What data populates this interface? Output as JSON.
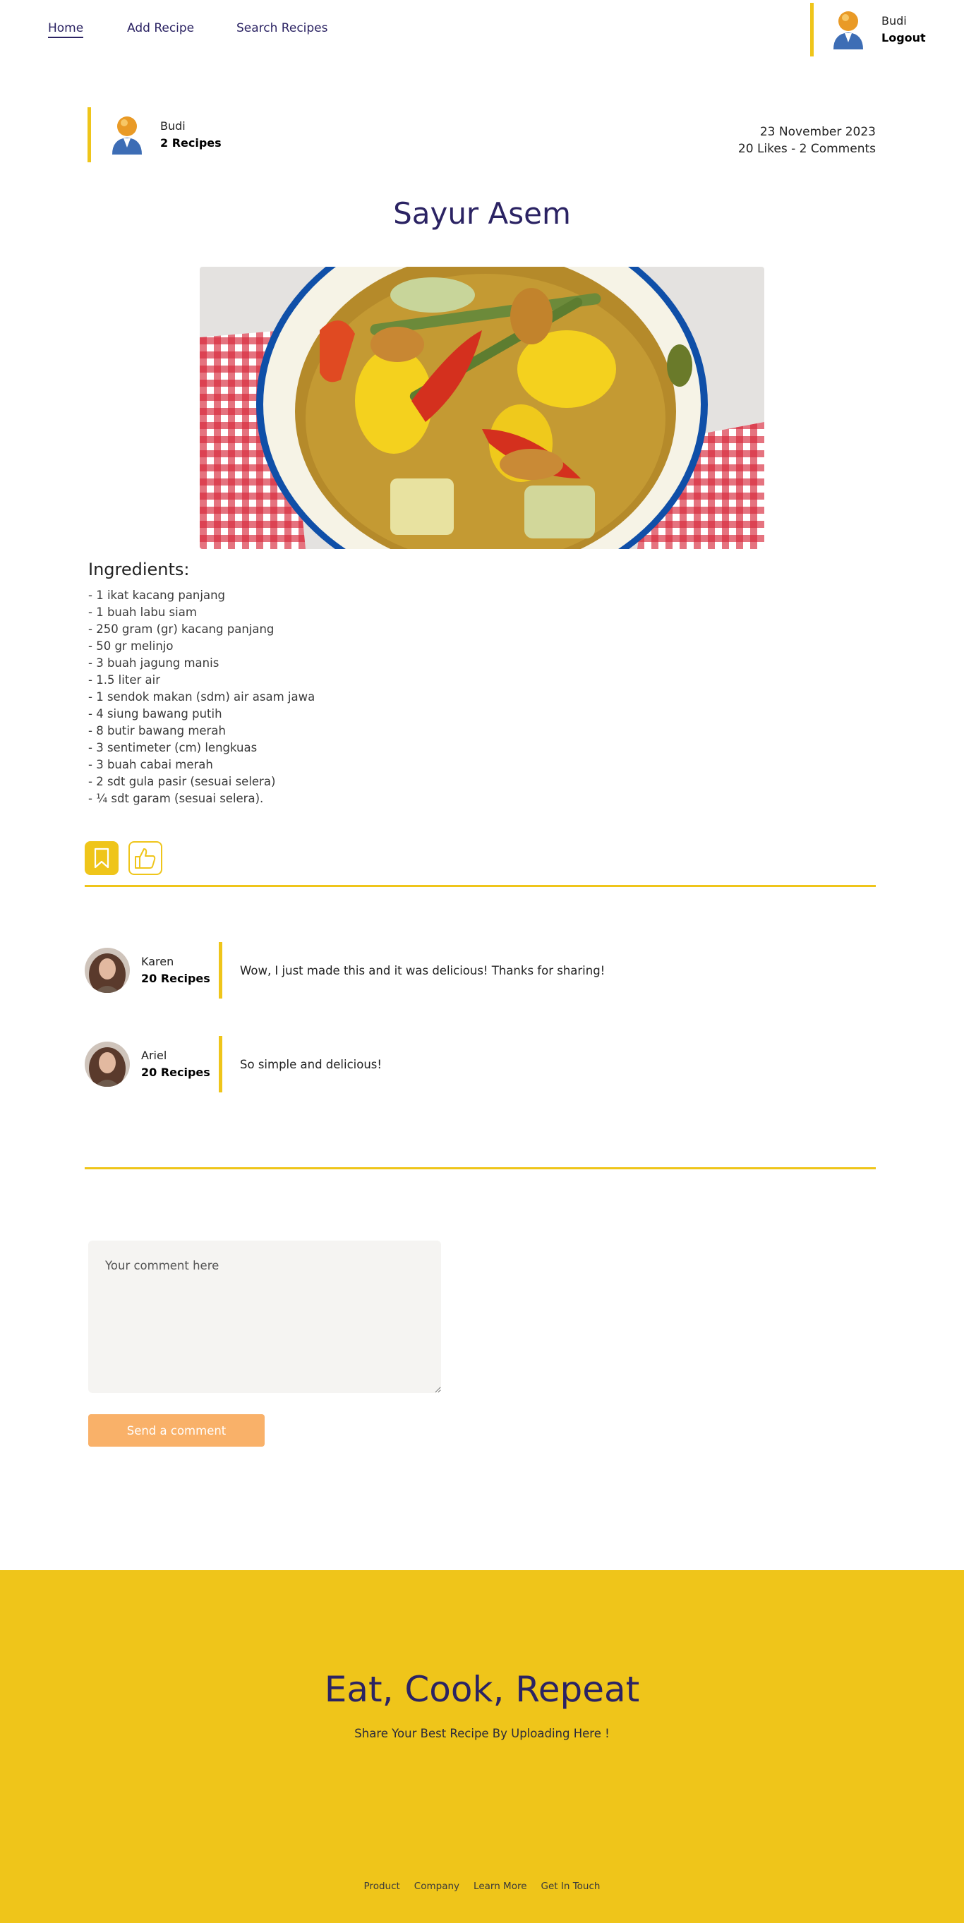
{
  "nav": {
    "links": [
      "Home",
      "Add Recipe",
      "Search Recipes"
    ],
    "user_name": "Budi",
    "logout_label": "Logout",
    "accent": "#efc51a"
  },
  "author": {
    "name": "Budi",
    "recipes": "2 Recipes",
    "date": "23 November 2023",
    "stats": "20 Likes - 2 Comments"
  },
  "recipe": {
    "title": "Sayur Asem",
    "ingredients_heading": "Ingredients:",
    "ingredients": [
      "- 1 ikat kacang panjang",
      "- 1 buah labu siam",
      "- 250 gram (gr) kacang panjang",
      "- 50 gr melinjo",
      "- 3 buah jagung manis",
      "- 1.5 liter air",
      "- 1 sendok makan (sdm) air asam jawa",
      "- 4 siung bawang putih",
      "- 8 butir bawang merah",
      "- 3 sentimeter (cm) lengkuas",
      "- 3 buah cabai merah",
      "- 2 sdt gula pasir (sesuai selera)",
      "- ¼ sdt garam (sesuai selera)."
    ]
  },
  "actions": {
    "save_icon": "bookmark-icon",
    "like_icon": "thumbs-up-icon"
  },
  "comments": [
    {
      "name": "Karen",
      "recipes": "20 Recipes",
      "text": "Wow, I just made this and it was delicious! Thanks for sharing!"
    },
    {
      "name": "Ariel",
      "recipes": "20 Recipes",
      "text": "So simple and delicious!"
    }
  ],
  "comment_form": {
    "placeholder": "Your comment here",
    "submit_label": "Send a comment"
  },
  "footer": {
    "title": "Eat, Cook, Repeat",
    "subtitle": "Share Your Best Recipe By Uploading Here !",
    "links": [
      "Product",
      "Company",
      "Learn More",
      "Get In Touch"
    ],
    "background": "#efc51a"
  }
}
